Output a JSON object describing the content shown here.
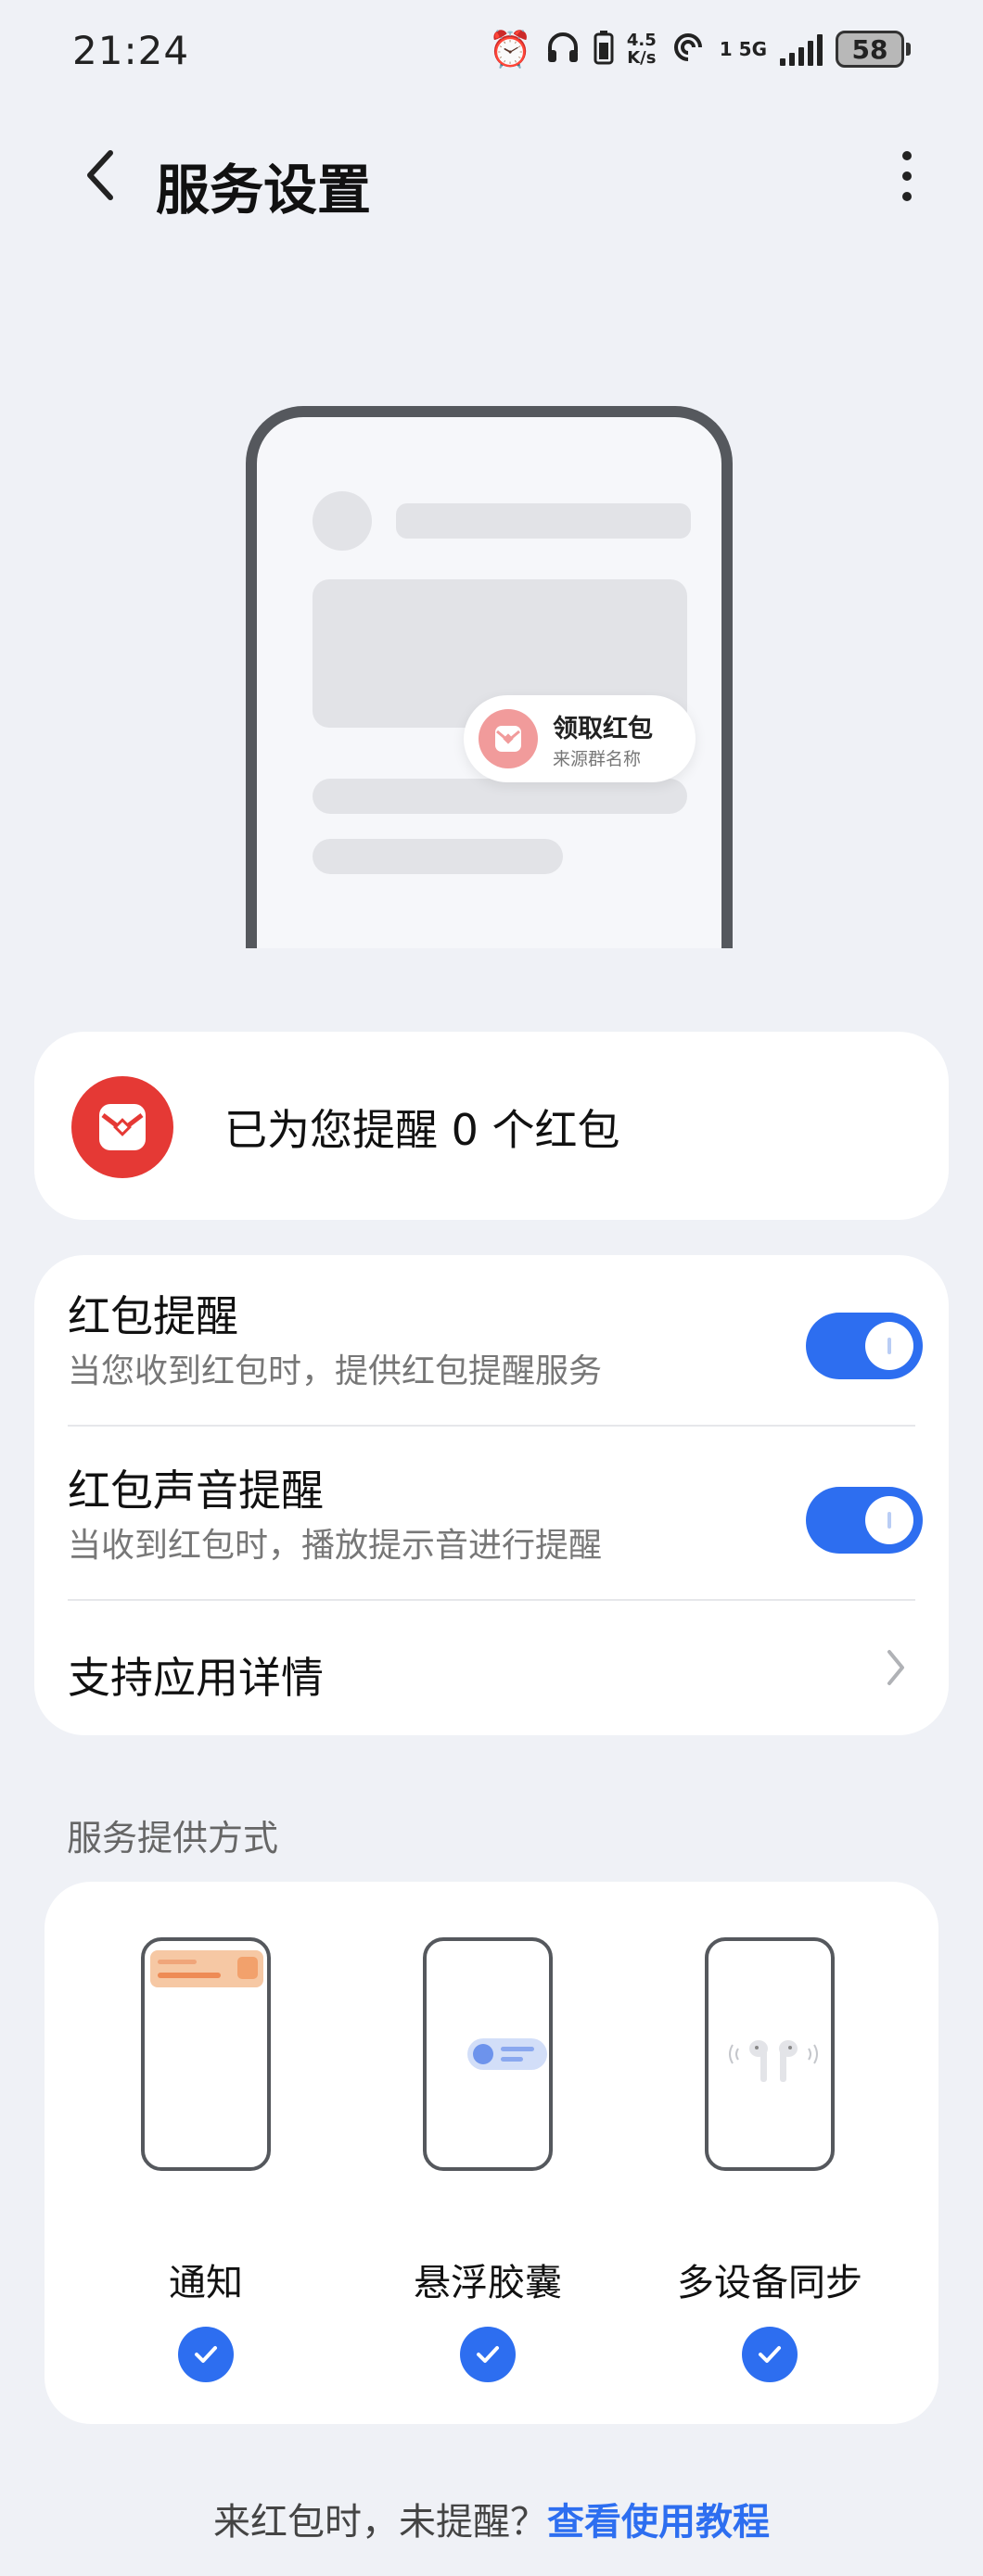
{
  "status_bar": {
    "time": "21:24",
    "net_speed_top": "4.5",
    "net_speed_bottom": "K/s",
    "network_type": "5G",
    "sim_index": "1",
    "battery_level": "58",
    "icons": [
      "alarm-icon",
      "headphones-icon",
      "battery-saver-icon",
      "hotspot-icon",
      "signal-icon",
      "battery-icon"
    ]
  },
  "header": {
    "title": "服务设置"
  },
  "hero": {
    "popup_title": "领取红包",
    "popup_subtitle": "来源群名称"
  },
  "summary": {
    "text": "已为您提醒 0 个红包"
  },
  "settings": [
    {
      "title": "红包提醒",
      "subtitle": "当您收到红包时，提供红包提醒服务",
      "enabled": true
    },
    {
      "title": "红包声音提醒",
      "subtitle": "当收到红包时，播放提示音进行提醒",
      "enabled": true
    },
    {
      "title": "支持应用详情"
    }
  ],
  "service_section": {
    "label": "服务提供方式",
    "modes": [
      {
        "label": "通知",
        "checked": true
      },
      {
        "label": "悬浮胶囊",
        "checked": true
      },
      {
        "label": "多设备同步",
        "checked": true
      }
    ]
  },
  "footer": {
    "prefix": "来红包时，未提醒？",
    "link": "查看使用教程"
  },
  "colors": {
    "background": "#eff1f6",
    "accent_blue": "#2d6ef0",
    "red_packet": "#e53935",
    "notification_orange": "#f6b98a"
  }
}
